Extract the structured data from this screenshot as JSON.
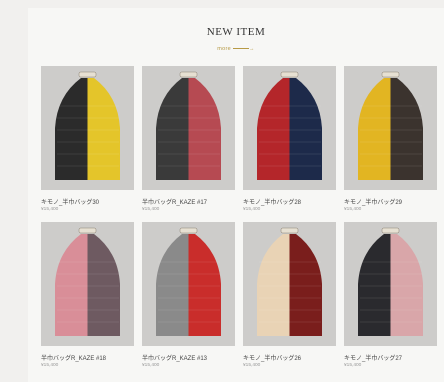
{
  "section": {
    "title": "NEW ITEM",
    "more_label": "more"
  },
  "products": [
    {
      "name": "キモノ_半巾バッグ30",
      "price": "¥15,400",
      "left_color": "#2b2b2b",
      "right_color": "#e4c52a",
      "icon": "bag-photo"
    },
    {
      "name": "半巾バッグR_KAZE #17",
      "price": "¥15,400",
      "left_color": "#3a3a3a",
      "right_color": "#b64a52",
      "icon": "bag-photo"
    },
    {
      "name": "キモノ_半巾バッグ28",
      "price": "¥15,400",
      "left_color": "#b4262a",
      "right_color": "#1d2a4a",
      "icon": "bag-photo"
    },
    {
      "name": "キモノ_半巾バッグ29",
      "price": "¥15,400",
      "left_color": "#e2b522",
      "right_color": "#3b332e",
      "icon": "bag-photo"
    },
    {
      "name": "半巾バッグR_KAZE #18",
      "price": "¥15,400",
      "left_color": "#d98e98",
      "right_color": "#6e5a61",
      "icon": "bag-photo"
    },
    {
      "name": "半巾バッグR_KAZE #13",
      "price": "¥15,400",
      "left_color": "#8a8a8a",
      "right_color": "#c92d2b",
      "icon": "bag-photo"
    },
    {
      "name": "キモノ_半巾バッグ26",
      "price": "¥15,400",
      "left_color": "#e9d3b5",
      "right_color": "#7a1e1c",
      "icon": "bag-photo"
    },
    {
      "name": "キモノ_半巾バッグ27",
      "price": "¥15,400",
      "left_color": "#2a2a2e",
      "right_color": "#d9a6a9",
      "icon": "bag-photo"
    }
  ]
}
